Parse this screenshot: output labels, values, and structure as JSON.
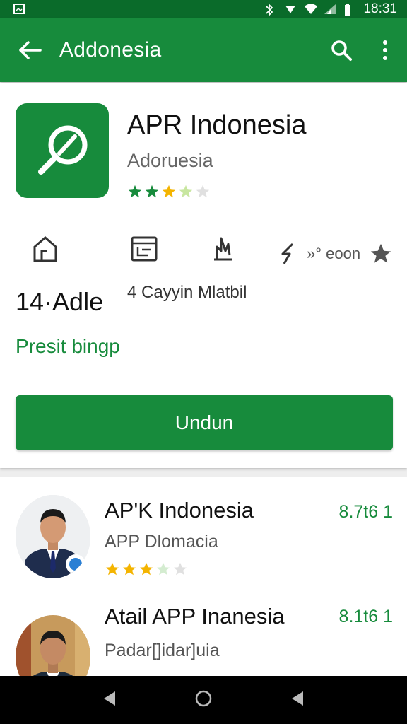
{
  "status_bar": {
    "time": "18:31"
  },
  "app_bar": {
    "title": "Addonesia"
  },
  "app": {
    "name": "APR Indonesia",
    "developer": "Adoruesia",
    "rating_stars": 3.5,
    "stats": {
      "size_value": "14·Adle",
      "installs_text": "4 Cayyin Mlatbil",
      "rating_label": "»° eoon"
    },
    "link": "Presit bingp",
    "install_label": "Undun"
  },
  "colors": {
    "primary": "#178b3c",
    "primary_dark": "#0a6b2a",
    "star": "#f4b400",
    "star_green": "#178b3c"
  },
  "list": [
    {
      "title": "AP'K Indonesia",
      "subtitle": "APP Dlomacia",
      "rating": "8.7t6 1",
      "stars": 3
    },
    {
      "title": "Atail APP Inanesia",
      "subtitle": "Padar[]idar]uia",
      "rating": "8.1t6 1"
    }
  ]
}
